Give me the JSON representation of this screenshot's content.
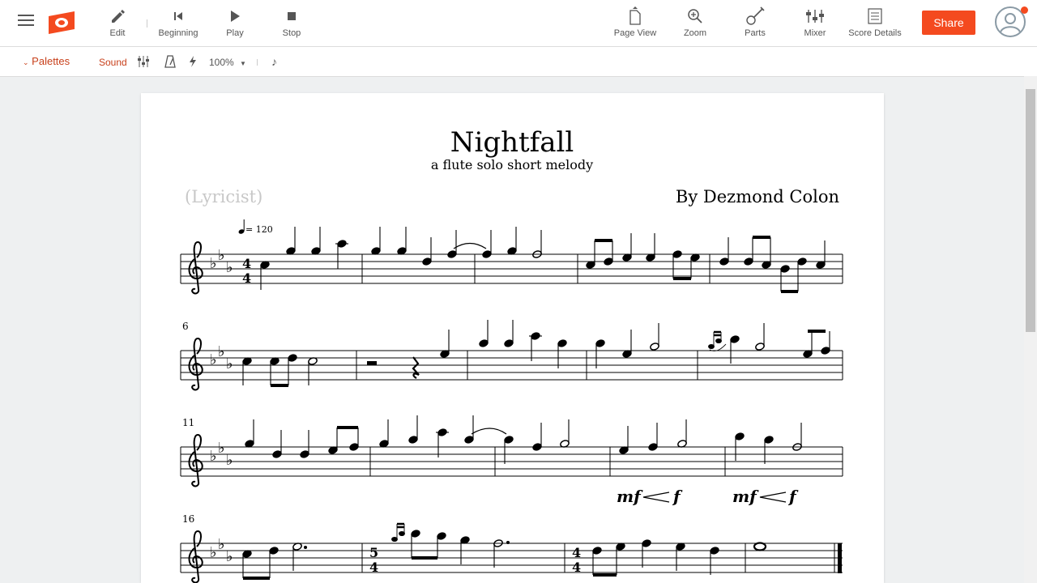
{
  "toolbar": {
    "edit": "Edit",
    "beginning": "Beginning",
    "play": "Play",
    "stop": "Stop",
    "page_view": "Page View",
    "zoom": "Zoom",
    "parts": "Parts",
    "mixer": "Mixer",
    "score_details": "Score Details",
    "share": "Share"
  },
  "subtoolbar": {
    "palettes": "Palettes",
    "sound": "Sound",
    "zoom_level": "100%"
  },
  "score": {
    "title": "Nightfall",
    "subtitle": "a flute solo short melody",
    "lyricist": "(Lyricist)",
    "composer": "By Dezmond Colon",
    "tempo": "= 120",
    "measure_numbers": [
      "6",
      "11",
      "16"
    ],
    "dynamics": [
      "mf",
      "f",
      "mf",
      "f"
    ],
    "time_signatures": [
      "4/4",
      "5/4",
      "4/4"
    ]
  },
  "colors": {
    "accent": "#f44a1f",
    "page": "#ffffff",
    "background": "#eef0f1"
  }
}
